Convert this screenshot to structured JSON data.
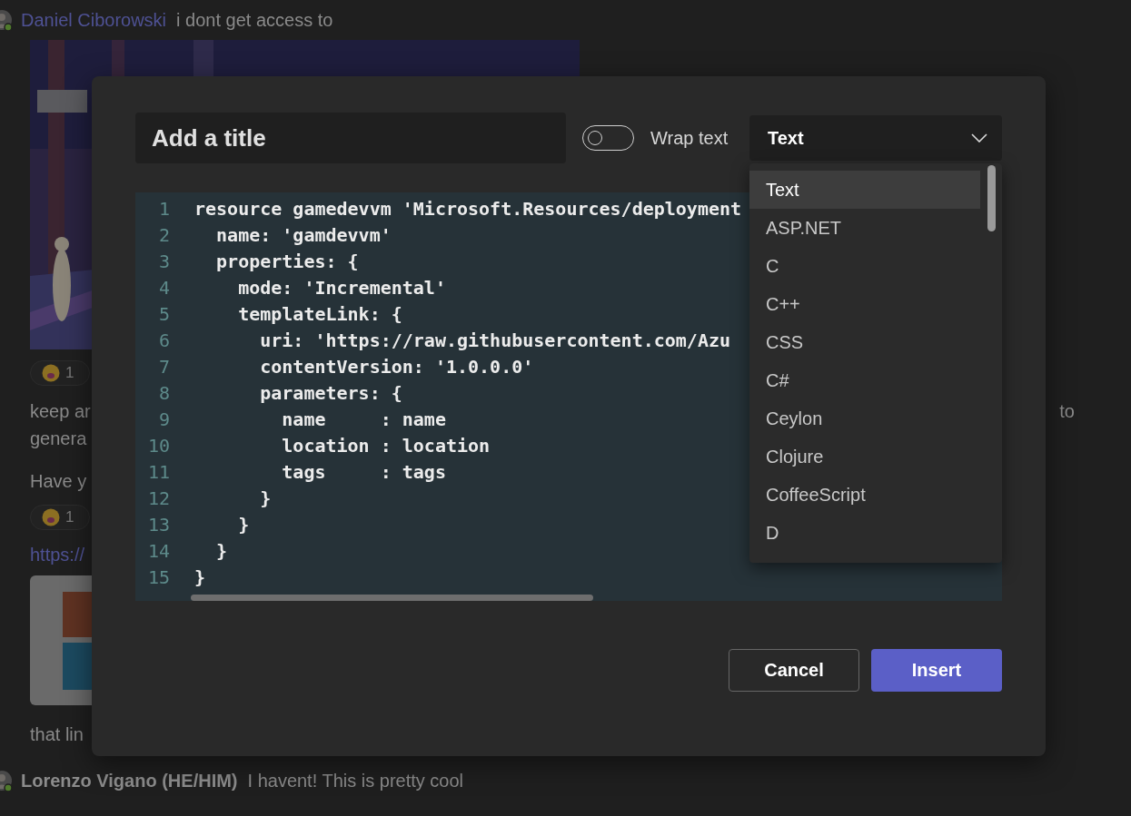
{
  "chat": {
    "blocks": [
      {
        "kind": "message",
        "author": "Daniel Ciborowski",
        "color": "#4e5193",
        "text": "i dont get access to"
      },
      {
        "kind": "picture"
      },
      {
        "kind": "reaction",
        "count": "1"
      },
      {
        "kind": "text",
        "lines": [
          "keep ar",
          "genera"
        ],
        "trailing": "to"
      },
      {
        "kind": "text",
        "lines": [
          "Have y"
        ]
      },
      {
        "kind": "reaction",
        "count": "1"
      },
      {
        "kind": "link",
        "text": "https://"
      },
      {
        "kind": "link_preview"
      },
      {
        "kind": "text",
        "lines": [
          "that lin"
        ]
      },
      {
        "kind": "message",
        "author": "Lorenzo Vigano (HE/HIM)",
        "color": "#8c8c8c",
        "text": "I havent! This is pretty cool"
      }
    ]
  },
  "dialog": {
    "title_field": {
      "placeholder": "Add a title"
    },
    "wrap_toggle": {
      "label": "Wrap text",
      "on": false
    },
    "language": {
      "value": "Text",
      "expanded": true,
      "options": [
        {
          "label": "Text",
          "selected": true
        },
        {
          "label": "ASP.NET",
          "selected": false
        },
        {
          "label": "C",
          "selected": false
        },
        {
          "label": "C++",
          "selected": false
        },
        {
          "label": "CSS",
          "selected": false
        },
        {
          "label": "C#",
          "selected": false
        },
        {
          "label": "Ceylon",
          "selected": false
        },
        {
          "label": "Clojure",
          "selected": false
        },
        {
          "label": "CoffeeScript",
          "selected": false
        },
        {
          "label": "D",
          "selected": false
        }
      ]
    },
    "code": {
      "lines": [
        {
          "number": "1",
          "text": "resource gamedevvm 'Microsoft.Resources/deployment"
        },
        {
          "number": "2",
          "text": "  name: 'gamdevvm'"
        },
        {
          "number": "3",
          "text": "  properties: {"
        },
        {
          "number": "4",
          "text": "    mode: 'Incremental'"
        },
        {
          "number": "5",
          "text": "    templateLink: {"
        },
        {
          "number": "6",
          "text": "      uri: 'https://raw.githubusercontent.com/Azu"
        },
        {
          "number": "7",
          "text": "      contentVersion: '1.0.0.0'"
        },
        {
          "number": "8",
          "text": "      parameters: {"
        },
        {
          "number": "9",
          "text": "        name     : name"
        },
        {
          "number": "10",
          "text": "        location : location"
        },
        {
          "number": "11",
          "text": "        tags     : tags"
        },
        {
          "number": "12",
          "text": "      }"
        },
        {
          "number": "13",
          "text": "    }"
        },
        {
          "number": "14",
          "text": "  }"
        },
        {
          "number": "15",
          "text": "}"
        }
      ]
    },
    "buttons": [
      {
        "label": "Cancel",
        "kind": "secondary"
      },
      {
        "label": "Insert",
        "kind": "primary"
      }
    ]
  }
}
